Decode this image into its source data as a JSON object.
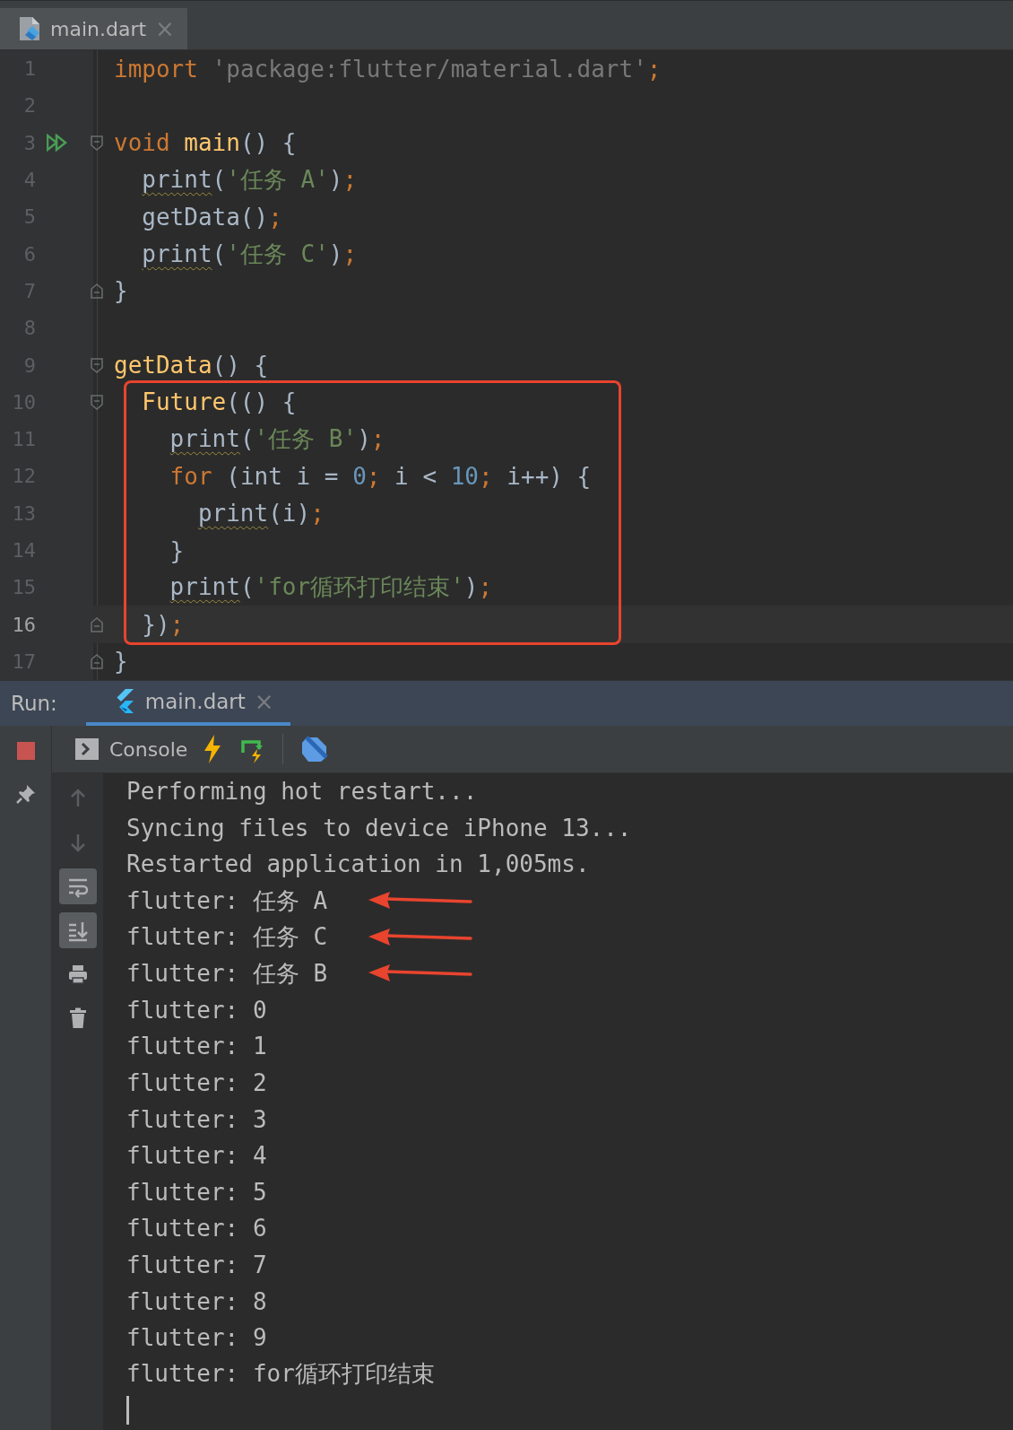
{
  "editor_tabs": [
    {
      "label": "main.dart",
      "close": "×",
      "selected": true
    }
  ],
  "code_lines": [
    {
      "number": "1",
      "run": false,
      "fold_start": false,
      "fold_end": false,
      "boxed": false,
      "current": false,
      "tokens": [
        {
          "t": "import",
          "color": "#cc7832",
          "kind": "code"
        },
        {
          "t": " 'package:flutter/material.dart'",
          "color": "#787878",
          "kind": "code"
        },
        {
          "t": ";",
          "color": "#cc7832",
          "kind": "code"
        }
      ]
    },
    {
      "number": "2",
      "run": false,
      "fold_start": false,
      "fold_end": false,
      "boxed": false,
      "current": false
    },
    {
      "number": "3",
      "run": true,
      "fold_start": true,
      "fold_end": false,
      "boxed": false,
      "current": false,
      "tokens": [
        {
          "t": "void",
          "color": "#cc7832",
          "kind": "code"
        },
        {
          "t": " main",
          "color": "#ffc66d",
          "kind": "code"
        },
        {
          "t": "() {",
          "color": "#a9b7c6",
          "kind": "code"
        }
      ],
      "children": [
        {
          "number": "4",
          "run": false,
          "fold_start": false,
          "fold_end": false,
          "boxed": false,
          "current": false,
          "tokens": [
            {
              "t": "print",
              "color": "#a9b7c6",
              "kind": "warning"
            },
            {
              "t": "(",
              "color": "#a9b7c6",
              "kind": "code"
            },
            {
              "t": "'任务 A'",
              "color": "#6a8759",
              "kind": "code"
            },
            {
              "t": ")",
              "color": "#a9b7c6",
              "kind": "code"
            },
            {
              "t": ";",
              "color": "#cc7832",
              "kind": "code"
            }
          ]
        },
        {
          "number": "5",
          "run": false,
          "fold_start": false,
          "fold_end": false,
          "boxed": false,
          "current": false,
          "tokens": [
            {
              "t": "getData()",
              "color": "#a9b7c6",
              "kind": "code"
            },
            {
              "t": ";",
              "color": "#cc7832",
              "kind": "code"
            }
          ]
        },
        {
          "number": "6",
          "run": false,
          "fold_start": false,
          "fold_end": false,
          "boxed": false,
          "current": false,
          "tokens": [
            {
              "t": "print",
              "color": "#a9b7c6",
              "kind": "warning"
            },
            {
              "t": "(",
              "color": "#a9b7c6",
              "kind": "code"
            },
            {
              "t": "'任务 C'",
              "color": "#6a8759",
              "kind": "code"
            },
            {
              "t": ")",
              "color": "#a9b7c6",
              "kind": "code"
            },
            {
              "t": ";",
              "color": "#cc7832",
              "kind": "code"
            }
          ]
        }
      ]
    },
    {
      "number": "7",
      "run": false,
      "fold_start": false,
      "fold_end": true,
      "boxed": false,
      "current": false,
      "tokens": [
        {
          "t": "}",
          "color": "#a9b7c6",
          "kind": "code"
        }
      ]
    },
    {
      "number": "8",
      "run": false,
      "fold_start": false,
      "fold_end": false,
      "boxed": false,
      "current": false
    },
    {
      "number": "9",
      "run": false,
      "fold_start": true,
      "fold_end": false,
      "boxed": false,
      "current": false,
      "tokens": [
        {
          "t": "getData",
          "color": "#ffc66d",
          "kind": "code"
        },
        {
          "t": "() {",
          "color": "#a9b7c6",
          "kind": "code"
        }
      ],
      "children": [
        {
          "number": "10",
          "run": false,
          "fold_start": true,
          "fold_end": false,
          "boxed": true,
          "current": false,
          "tokens": [
            {
              "t": "Future",
              "color": "#ffc66d",
              "kind": "code"
            },
            {
              "t": "(() {",
              "color": "#a9b7c6",
              "kind": "code"
            }
          ],
          "children": [
            {
              "number": "11",
              "run": false,
              "fold_start": false,
              "fold_end": false,
              "boxed": true,
              "current": false,
              "tokens": [
                {
                  "t": "print",
                  "color": "#a9b7c6",
                  "kind": "warning"
                },
                {
                  "t": "(",
                  "color": "#a9b7c6",
                  "kind": "code"
                },
                {
                  "t": "'任务 B'",
                  "color": "#6a8759",
                  "kind": "code"
                },
                {
                  "t": ")",
                  "color": "#a9b7c6",
                  "kind": "code"
                },
                {
                  "t": ";",
                  "color": "#cc7832",
                  "kind": "code"
                }
              ]
            },
            {
              "number": "12",
              "run": false,
              "fold_start": false,
              "fold_end": false,
              "boxed": true,
              "current": false,
              "tokens": [
                {
                  "t": "for",
                  "color": "#cc7832",
                  "kind": "code"
                },
                {
                  "t": " (int i = ",
                  "color": "#a9b7c6",
                  "kind": "code"
                },
                {
                  "t": "0",
                  "color": "#6897bb",
                  "kind": "code"
                },
                {
                  "t": ";",
                  "color": "#cc7832",
                  "kind": "code"
                },
                {
                  "t": " i < ",
                  "color": "#a9b7c6",
                  "kind": "code"
                },
                {
                  "t": "10",
                  "color": "#6897bb",
                  "kind": "code"
                },
                {
                  "t": ";",
                  "color": "#cc7832",
                  "kind": "code"
                },
                {
                  "t": " i++) {",
                  "color": "#a9b7c6",
                  "kind": "code"
                }
              ],
              "children": [
                {
                  "number": "13",
                  "run": false,
                  "fold_start": false,
                  "fold_end": false,
                  "boxed": true,
                  "current": false,
                  "tokens": [
                    {
                      "t": "print",
                      "color": "#a9b7c6",
                      "kind": "warning"
                    },
                    {
                      "t": "(i)",
                      "color": "#a9b7c6",
                      "kind": "code"
                    },
                    {
                      "t": ";",
                      "color": "#cc7832",
                      "kind": "code"
                    }
                  ]
                }
              ]
            },
            {
              "number": "14",
              "run": false,
              "fold_start": false,
              "fold_end": false,
              "boxed": true,
              "current": false,
              "tokens": [
                {
                  "t": "}",
                  "color": "#a9b7c6",
                  "kind": "code"
                }
              ]
            },
            {
              "number": "15",
              "run": false,
              "fold_start": false,
              "fold_end": false,
              "boxed": true,
              "current": false,
              "tokens": [
                {
                  "t": "print",
                  "color": "#a9b7c6",
                  "kind": "warning"
                },
                {
                  "t": "(",
                  "color": "#a9b7c6",
                  "kind": "code"
                },
                {
                  "t": "'for循环打印结束'",
                  "color": "#6a8759",
                  "kind": "code"
                },
                {
                  "t": ")",
                  "color": "#a9b7c6",
                  "kind": "code"
                },
                {
                  "t": ";",
                  "color": "#cc7832",
                  "kind": "code"
                }
              ]
            }
          ]
        },
        {
          "number": "16",
          "run": false,
          "fold_start": false,
          "fold_end": true,
          "boxed": true,
          "current": true,
          "tokens": [
            {
              "t": "})",
              "color": "#a9b7c6",
              "kind": "code"
            },
            {
              "t": ";",
              "color": "#cc7832",
              "kind": "code"
            }
          ]
        }
      ]
    },
    {
      "number": "17",
      "run": false,
      "fold_start": false,
      "fold_end": true,
      "boxed": false,
      "current": false,
      "tokens": [
        {
          "t": "}",
          "color": "#a9b7c6",
          "kind": "code"
        }
      ]
    }
  ],
  "run_panel": {
    "label": "Run:",
    "tabs": [
      {
        "label": "main.dart",
        "close": "×",
        "selected": true
      }
    ],
    "toolbar": [
      {
        "kind": "console",
        "label": "Console"
      },
      {
        "kind": "hot-reload"
      },
      {
        "kind": "hot-restart"
      },
      {
        "kind": "devtools"
      }
    ],
    "side_tools": [
      {
        "kind": "stop",
        "on": false,
        "disabled": false
      },
      {
        "kind": "pin",
        "on": false,
        "disabled": false
      },
      {
        "kind": "up",
        "on": false,
        "disabled": true
      },
      {
        "kind": "down",
        "on": false,
        "disabled": true
      },
      {
        "kind": "wrap",
        "on": true,
        "disabled": false
      },
      {
        "kind": "scroll-end",
        "on": true,
        "disabled": false
      },
      {
        "kind": "print",
        "on": false,
        "disabled": false
      },
      {
        "kind": "trash",
        "on": false,
        "disabled": false
      }
    ],
    "output": [
      {
        "text": "Performing hot restart...",
        "arrow": false
      },
      {
        "text": "Syncing files to device iPhone 13...",
        "arrow": false
      },
      {
        "text": "Restarted application in 1,005ms.",
        "arrow": false
      },
      {
        "text": "flutter: 任务 A",
        "arrow": true
      },
      {
        "text": "flutter: 任务 C",
        "arrow": true
      },
      {
        "text": "flutter: 任务 B",
        "arrow": true
      },
      {
        "text": "flutter: 0",
        "arrow": false
      },
      {
        "text": "flutter: 1",
        "arrow": false
      },
      {
        "text": "flutter: 2",
        "arrow": false
      },
      {
        "text": "flutter: 3",
        "arrow": false
      },
      {
        "text": "flutter: 4",
        "arrow": false
      },
      {
        "text": "flutter: 5",
        "arrow": false
      },
      {
        "text": "flutter: 6",
        "arrow": false
      },
      {
        "text": "flutter: 7",
        "arrow": false
      },
      {
        "text": "flutter: 8",
        "arrow": false
      },
      {
        "text": "flutter: 9",
        "arrow": false
      },
      {
        "text": "flutter: for循环打印结束",
        "arrow": false
      }
    ]
  }
}
